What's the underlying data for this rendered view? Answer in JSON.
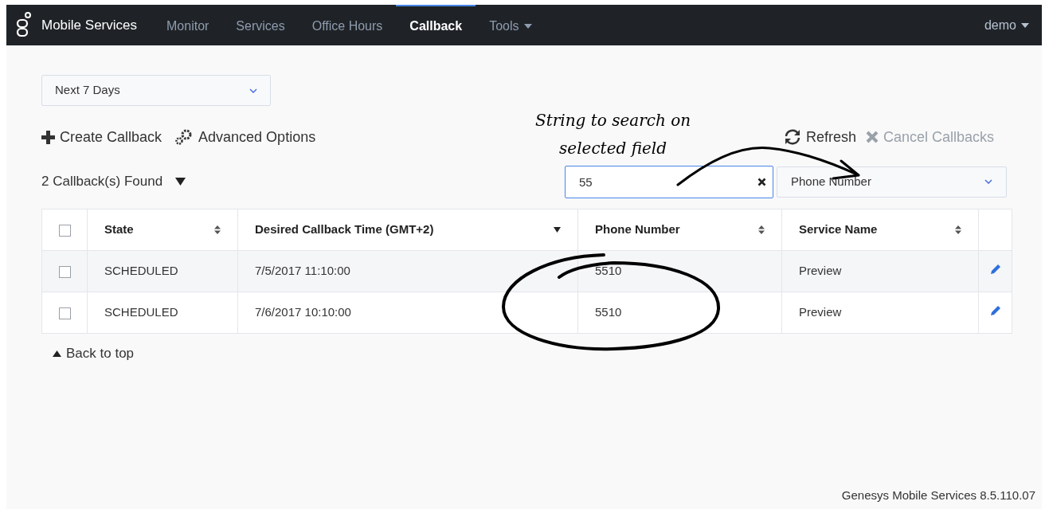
{
  "navbar": {
    "brand": "Mobile Services",
    "items": [
      {
        "label": "Monitor",
        "selected": false,
        "dropdown": false
      },
      {
        "label": "Services",
        "selected": false,
        "dropdown": false
      },
      {
        "label": "Office Hours",
        "selected": false,
        "dropdown": false
      },
      {
        "label": "Callback",
        "selected": true,
        "dropdown": false
      },
      {
        "label": "Tools",
        "selected": false,
        "dropdown": true
      }
    ],
    "user": "demo"
  },
  "period_select": {
    "value": "Next 7 Days"
  },
  "actions": [
    {
      "kind": "create",
      "label": "Create Callback",
      "disabled": false
    },
    {
      "kind": "advanced",
      "label": "Advanced Options",
      "disabled": false
    }
  ],
  "right_actions": [
    {
      "kind": "refresh",
      "label": "Refresh",
      "disabled": false
    },
    {
      "kind": "cancel",
      "label": "Cancel Callbacks",
      "disabled": true
    }
  ],
  "found": "2 Callback(s) Found",
  "search": {
    "value": "55"
  },
  "field_select": {
    "value": "Phone Number"
  },
  "annotation": {
    "text_lines": [
      "String to search on",
      "selected field"
    ]
  },
  "table": {
    "all_checked": false,
    "columns": [
      {
        "label": "State",
        "sorted": false
      },
      {
        "label": "Desired Callback Time (GMT+2)",
        "sorted": true
      },
      {
        "label": "Phone Number",
        "sorted": false
      },
      {
        "label": "Service Name",
        "sorted": false
      }
    ],
    "rows": [
      {
        "checked": false,
        "cells": [
          "SCHEDULED",
          "7/5/2017 11:10:00",
          "5510",
          "Preview"
        ]
      },
      {
        "checked": false,
        "cells": [
          "SCHEDULED",
          "7/6/2017 10:10:00",
          "5510",
          "Preview"
        ]
      }
    ]
  },
  "back_to_top": "Back to top",
  "footer": "Genesys Mobile Services 8.5.110.07"
}
